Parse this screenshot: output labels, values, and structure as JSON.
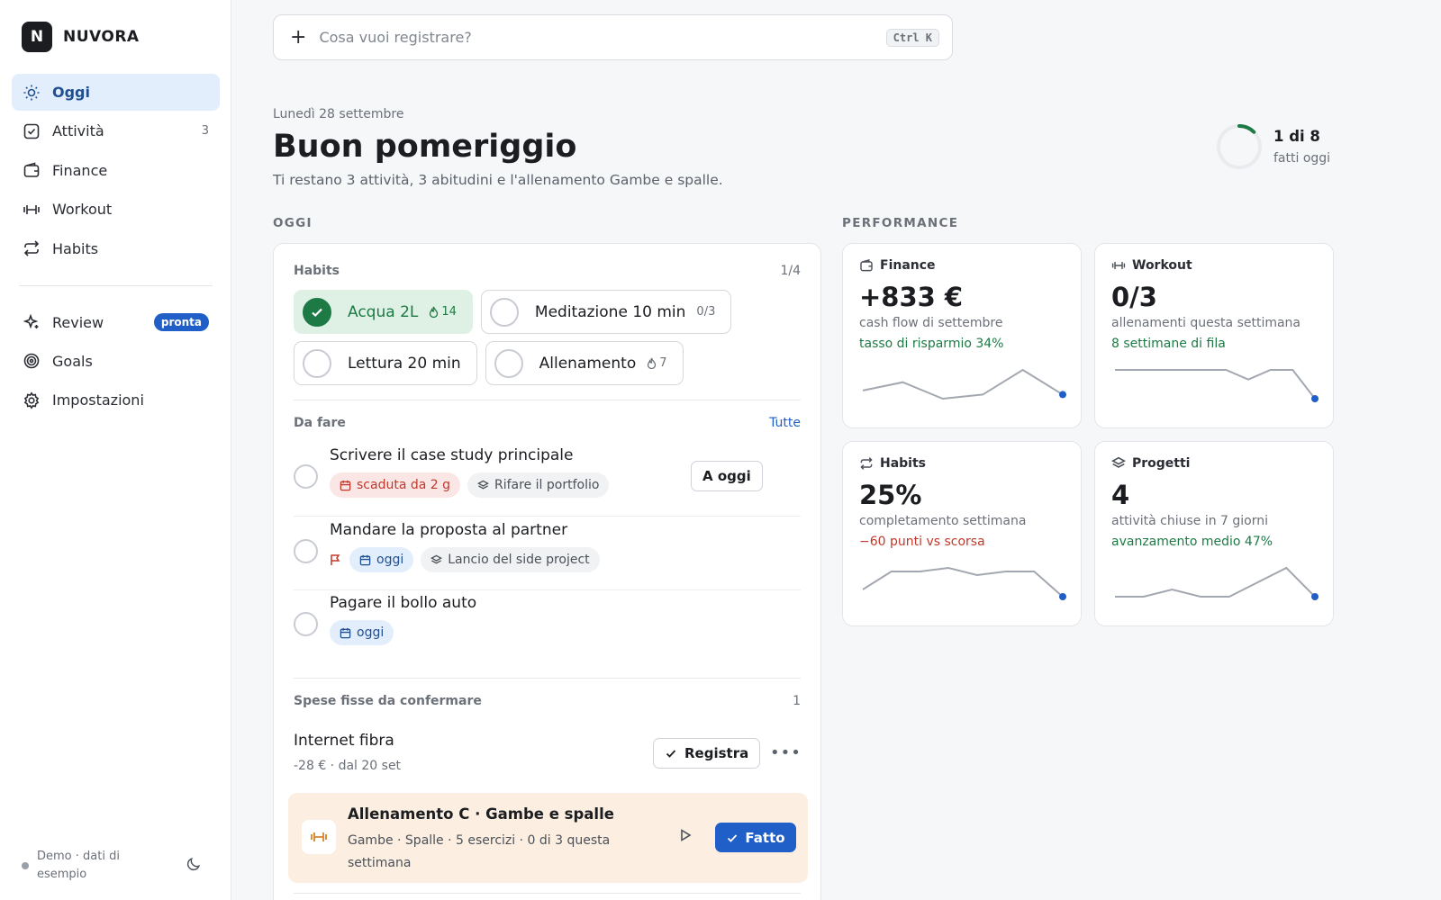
{
  "brand": {
    "logo_letter": "N",
    "name": "NUVORA"
  },
  "nav": {
    "items": [
      {
        "label": "Oggi",
        "icon": "sun-icon",
        "active": true
      },
      {
        "label": "Attività",
        "icon": "checkbox-icon",
        "count": "3"
      },
      {
        "label": "Finance",
        "icon": "wallet-icon"
      },
      {
        "label": "Workout",
        "icon": "dumbbell-icon"
      },
      {
        "label": "Habits",
        "icon": "repeat-icon"
      }
    ],
    "secondary": [
      {
        "label": "Review",
        "icon": "sparkle-icon",
        "badge": "pronta"
      },
      {
        "label": "Goals",
        "icon": "target-icon"
      },
      {
        "label": "Impostazioni",
        "icon": "gear-icon"
      }
    ],
    "footer": "Demo · dati di esempio"
  },
  "search": {
    "placeholder": "Cosa vuoi registrare?",
    "shortcut": "Ctrl K"
  },
  "header": {
    "date": "Lunedì 28 settembre",
    "greeting": "Buon pomeriggio",
    "subtitle": "Ti restano 3 attività, 3 abitudini e l'allenamento Gambe e spalle.",
    "progress_main": "1 di 8",
    "progress_sub": "fatti oggi",
    "progress_fraction": 0.125
  },
  "today": {
    "section_label": "OGGI",
    "habits": {
      "title": "Habits",
      "count": "1/4",
      "items": [
        {
          "label": "Acqua 2L",
          "meta": "14",
          "meta_icon": "flame-icon",
          "done": true
        },
        {
          "label": "Meditazione 10 min",
          "meta": "0/3",
          "done": false
        },
        {
          "label": "Lettura 20 min",
          "meta": "",
          "done": false
        },
        {
          "label": "Allenamento",
          "meta": "7",
          "meta_icon": "flame-icon",
          "done": false
        }
      ]
    },
    "todo": {
      "title": "Da fare",
      "link": "Tutte",
      "tasks": [
        {
          "title": "Scrivere il case study principale",
          "due": "scaduta da 2 g",
          "project": "Rifare il portfolio",
          "action": "A oggi"
        },
        {
          "title": "Mandare la proposta al partner",
          "due": "oggi",
          "project": "Lancio del side project"
        },
        {
          "title": "Pagare il bollo auto",
          "due": "oggi"
        }
      ]
    },
    "fixed": {
      "title": "Spese fisse da confermare",
      "count": "1",
      "name": "Internet fibra",
      "meta": "-28 € · dal 20 set",
      "action": "Registra"
    },
    "workout": {
      "title": "Allenamento C · Gambe e spalle",
      "subtitle": "Gambe · Spalle · 5 esercizi · 0 di 3 questa settimana",
      "action": "Fatto"
    }
  },
  "performance": {
    "section_label": "PERFORMANCE",
    "cards": [
      {
        "title": "Finance",
        "icon": "wallet-icon",
        "value": "+833 €",
        "desc": "cash flow di settembre",
        "trend": "tasso di risparmio 34%",
        "trend_type": "good",
        "spark": [
          5,
          7,
          3,
          4,
          10,
          4
        ]
      },
      {
        "title": "Workout",
        "icon": "dumbbell-icon",
        "value": "0/3",
        "desc": "allenamenti questa settimana",
        "trend": "8 settimane di fila",
        "trend_type": "good",
        "spark": [
          3,
          3,
          3,
          3,
          3,
          3,
          2,
          3,
          3,
          0
        ]
      },
      {
        "title": "Habits",
        "icon": "repeat-icon",
        "value": "25%",
        "desc": "completamento settimana",
        "trend": "−60 punti vs scorsa",
        "trend_type": "bad",
        "spark": [
          3,
          8,
          8,
          9,
          7,
          8,
          8,
          1
        ]
      },
      {
        "title": "Progetti",
        "icon": "layers-icon",
        "value": "4",
        "desc": "attività chiuse in 7 giorni",
        "trend": "avanzamento medio 47%",
        "trend_type": "good",
        "spark": [
          0,
          0,
          2,
          0,
          0,
          4,
          8,
          0
        ]
      }
    ]
  },
  "colors": {
    "accent": "#1f5fc7",
    "success": "#1d7a45",
    "danger": "#c0392b",
    "workout_bg": "#fcefe2"
  }
}
